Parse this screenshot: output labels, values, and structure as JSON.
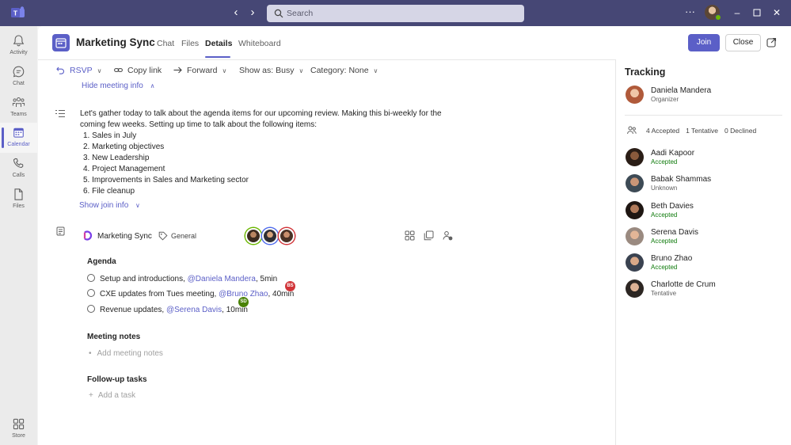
{
  "titlebar": {
    "search_placeholder": "Search",
    "more_label": "···",
    "accent": "#464775"
  },
  "rail": {
    "items": [
      {
        "label": "Activity",
        "icon": "bell-icon"
      },
      {
        "label": "Chat",
        "icon": "chat-icon"
      },
      {
        "label": "Teams",
        "icon": "teams-icon"
      },
      {
        "label": "Calendar",
        "icon": "calendar-icon",
        "active": true
      },
      {
        "label": "Calls",
        "icon": "phone-icon"
      },
      {
        "label": "Files",
        "icon": "file-icon"
      },
      {
        "label": "Store",
        "icon": "apps-icon"
      }
    ]
  },
  "header": {
    "title": "Marketing Sync",
    "tabs": [
      "Chat",
      "Files",
      "Details",
      "Whiteboard"
    ],
    "active_tab": "Details",
    "join_label": "Join",
    "close_label": "Close",
    "brand_color": "#5b5fc7"
  },
  "toolbar": {
    "rsvp": "RSVP",
    "copy_link": "Copy link",
    "forward": "Forward",
    "show_as": "Show as: Busy",
    "category": "Category: None"
  },
  "details": {
    "hide_info": "Hide meeting info",
    "description": "Let's gather today to talk about the agenda items for our upcoming review. Making this bi-weekly for the coming few weeks. Setting up time to talk about the following items:",
    "items": [
      "1. Sales in July",
      "2. Marketing objectives",
      "3. New Leadership",
      "4. Project Management",
      "5. Improvements in Sales and Marketing sector",
      "6. File cleanup"
    ],
    "show_join": "Show join info"
  },
  "loop": {
    "name": "Marketing Sync",
    "tag": "General",
    "agenda_title": "Agenda",
    "agenda": [
      {
        "text": "Setup and introductions, ",
        "mention": "@Daniela Mandera",
        "rest": ", 5min"
      },
      {
        "text": "CXE updates from Tues meeting, ",
        "mention": "@Bruno Zhao",
        "rest": ", 40min"
      },
      {
        "text": "Revenue updates, ",
        "mention": "@Serena Davis",
        "rest": ", 10min"
      }
    ],
    "cursors": [
      {
        "initials": "BS",
        "color": "#d13438"
      },
      {
        "initials": "SD",
        "color": "#498205"
      }
    ],
    "notes_title": "Meeting notes",
    "notes_placeholder": "Add meeting notes",
    "tasks_title": "Follow-up tasks",
    "tasks_placeholder": "Add a task"
  },
  "tracking": {
    "title": "Tracking",
    "organizer": {
      "name": "Daniela Mandera",
      "role": "Organizer"
    },
    "accepted": "4 Accepted",
    "tentative": "1 Tentative",
    "declined": "0 Declined",
    "people": [
      {
        "name": "Aadi Kapoor",
        "status": "Accepted"
      },
      {
        "name": "Babak Shammas",
        "status": "Unknown"
      },
      {
        "name": "Beth Davies",
        "status": "Accepted"
      },
      {
        "name": "Serena Davis",
        "status": "Accepted"
      },
      {
        "name": "Bruno Zhao",
        "status": "Accepted"
      },
      {
        "name": "Charlotte de Crum",
        "status": "Tentative"
      }
    ]
  }
}
